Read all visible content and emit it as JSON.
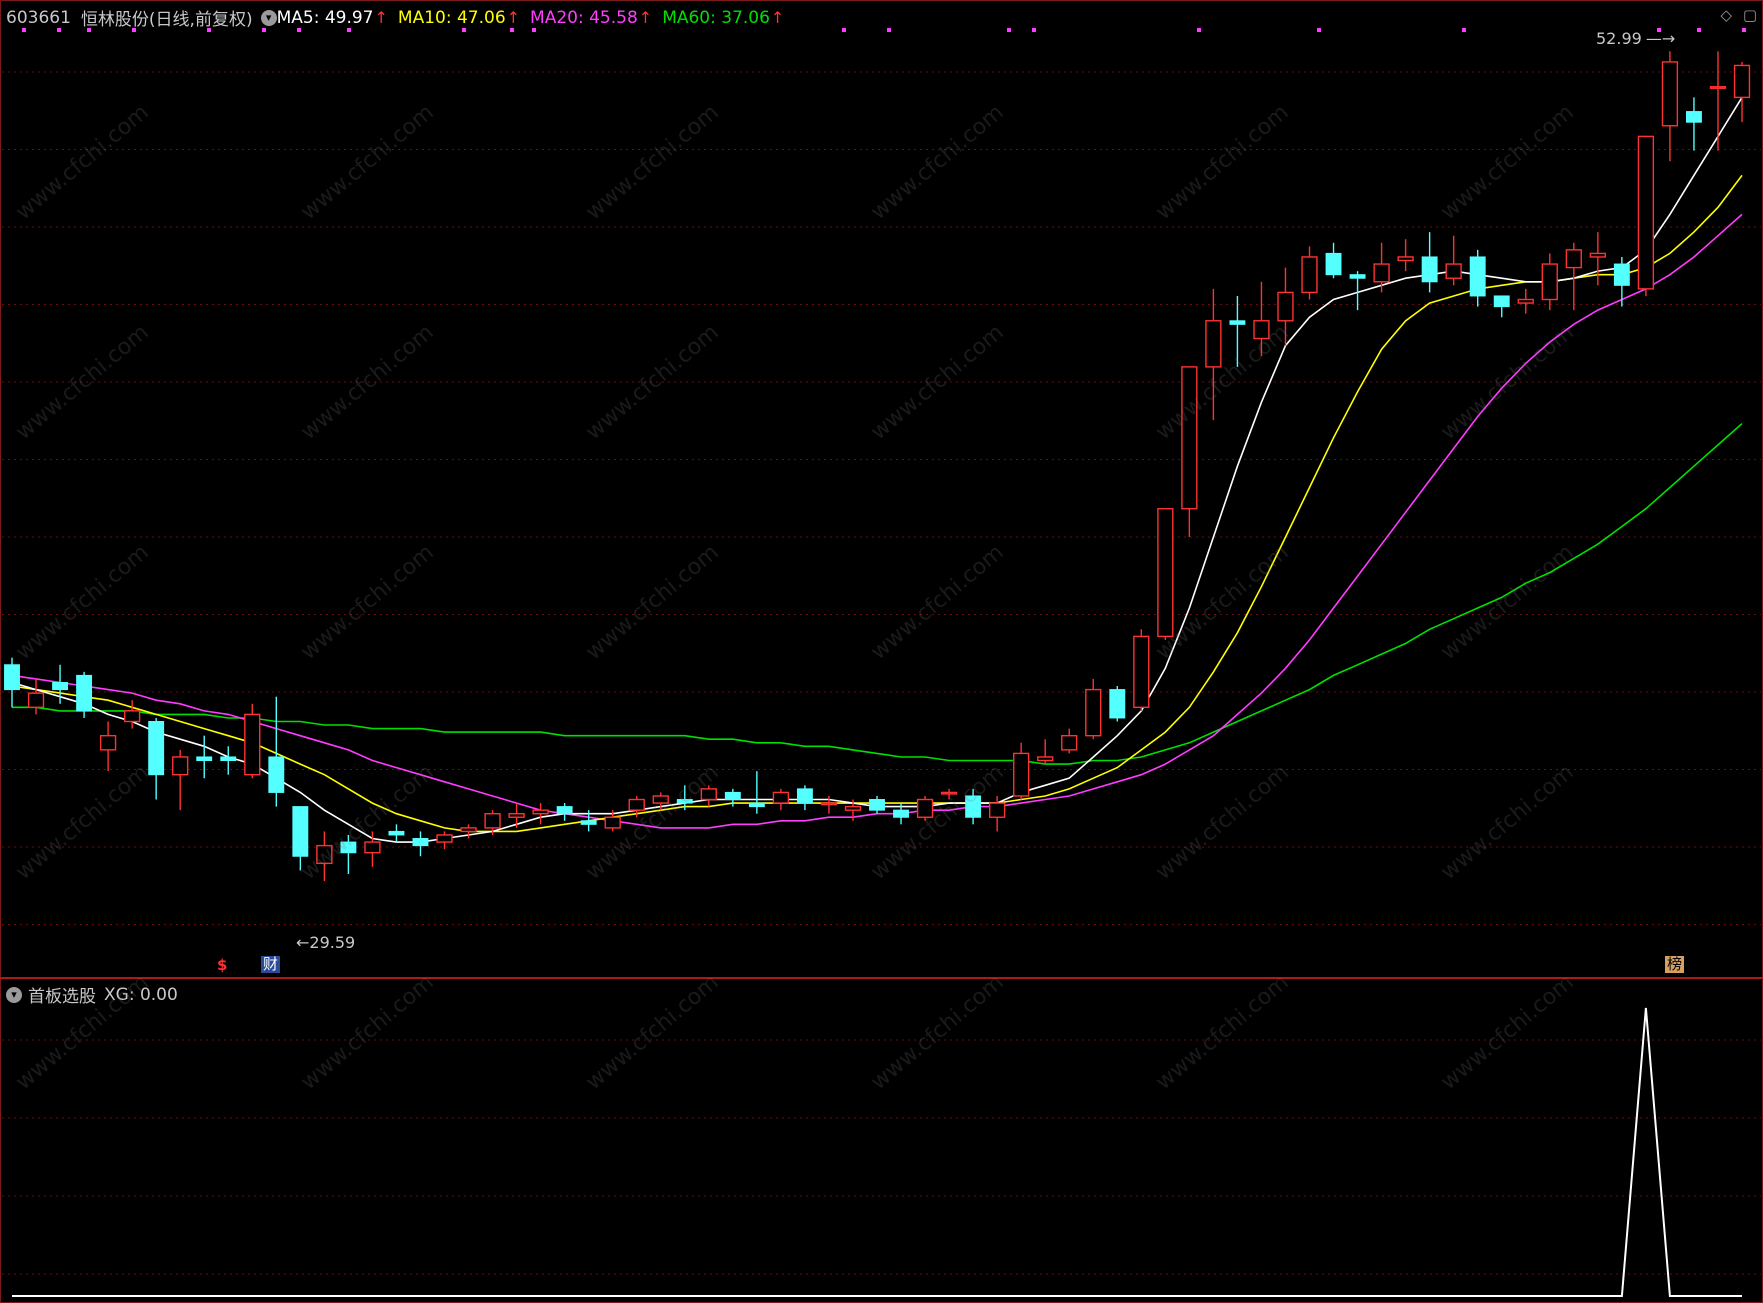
{
  "header": {
    "stock_code": "603661",
    "stock_name": "恒林股份",
    "period": "(日线,前复权)",
    "ma": [
      {
        "label": "MA5: 49.97",
        "color": "#ffffff"
      },
      {
        "label": "MA10: 47.06",
        "color": "#ffff00"
      },
      {
        "label": "MA20: 45.58",
        "color": "#ff3cff"
      },
      {
        "label": "MA60: 37.06",
        "color": "#00e000"
      }
    ],
    "up_arrow": "↑"
  },
  "annotations": {
    "high_label": "52.99",
    "low_label": "29.59",
    "tag_s": "$",
    "tag_cai": "财",
    "tag_bang": "榜"
  },
  "indicator": {
    "name": "首板选股",
    "value_label": "XG: 0.00"
  },
  "watermark": "www.cfchi.com",
  "colors": {
    "up": "#ff3232",
    "down": "#54ffff",
    "ma5": "#ffffff",
    "ma10": "#ffff00",
    "ma20": "#ff3cff",
    "ma60": "#00e000",
    "grid": "#6a0d0d"
  },
  "chart_data": {
    "type": "candlestick",
    "price_range": [
      28.5,
      54.5
    ],
    "candles": [
      {
        "o": 36.6,
        "c": 35.9,
        "h": 36.8,
        "l": 35.4
      },
      {
        "o": 35.4,
        "c": 35.8,
        "h": 36.2,
        "l": 35.2
      },
      {
        "o": 36.1,
        "c": 35.9,
        "h": 36.6,
        "l": 35.5
      },
      {
        "o": 36.3,
        "c": 35.3,
        "h": 36.4,
        "l": 35.1
      },
      {
        "o": 34.2,
        "c": 34.6,
        "h": 35.0,
        "l": 33.6
      },
      {
        "o": 35.0,
        "c": 35.3,
        "h": 35.6,
        "l": 34.8
      },
      {
        "o": 35.0,
        "c": 33.5,
        "h": 35.1,
        "l": 32.8
      },
      {
        "o": 33.5,
        "c": 34.0,
        "h": 34.2,
        "l": 32.5
      },
      {
        "o": 34.0,
        "c": 33.9,
        "h": 34.6,
        "l": 33.4
      },
      {
        "o": 34.0,
        "c": 33.9,
        "h": 34.3,
        "l": 33.5
      },
      {
        "o": 33.5,
        "c": 35.2,
        "h": 35.5,
        "l": 33.4
      },
      {
        "o": 34.0,
        "c": 33.0,
        "h": 35.7,
        "l": 32.6
      },
      {
        "o": 32.6,
        "c": 31.2,
        "h": 32.6,
        "l": 30.8
      },
      {
        "o": 31.0,
        "c": 31.5,
        "h": 31.9,
        "l": 30.5
      },
      {
        "o": 31.6,
        "c": 31.3,
        "h": 31.8,
        "l": 30.7
      },
      {
        "o": 31.3,
        "c": 31.6,
        "h": 31.9,
        "l": 30.9
      },
      {
        "o": 31.9,
        "c": 31.8,
        "h": 32.1,
        "l": 31.6
      },
      {
        "o": 31.7,
        "c": 31.5,
        "h": 31.9,
        "l": 31.2
      },
      {
        "o": 31.6,
        "c": 31.8,
        "h": 31.9,
        "l": 31.4
      },
      {
        "o": 31.9,
        "c": 32.0,
        "h": 32.1,
        "l": 31.7
      },
      {
        "o": 32.0,
        "c": 32.4,
        "h": 32.5,
        "l": 31.8
      },
      {
        "o": 32.3,
        "c": 32.4,
        "h": 32.7,
        "l": 32.0
      },
      {
        "o": 32.4,
        "c": 32.5,
        "h": 32.7,
        "l": 32.1
      },
      {
        "o": 32.6,
        "c": 32.4,
        "h": 32.7,
        "l": 32.2
      },
      {
        "o": 32.2,
        "c": 32.1,
        "h": 32.5,
        "l": 31.9
      },
      {
        "o": 32.0,
        "c": 32.3,
        "h": 32.5,
        "l": 31.9
      },
      {
        "o": 32.5,
        "c": 32.8,
        "h": 32.9,
        "l": 32.3
      },
      {
        "o": 32.7,
        "c": 32.9,
        "h": 33.0,
        "l": 32.5
      },
      {
        "o": 32.8,
        "c": 32.7,
        "h": 33.2,
        "l": 32.5
      },
      {
        "o": 32.8,
        "c": 33.1,
        "h": 33.2,
        "l": 32.6
      },
      {
        "o": 33.0,
        "c": 32.8,
        "h": 33.1,
        "l": 32.6
      },
      {
        "o": 32.7,
        "c": 32.6,
        "h": 33.6,
        "l": 32.4
      },
      {
        "o": 32.7,
        "c": 33.0,
        "h": 33.1,
        "l": 32.5
      },
      {
        "o": 33.1,
        "c": 32.7,
        "h": 33.2,
        "l": 32.5
      },
      {
        "o": 32.7,
        "c": 32.7,
        "h": 32.9,
        "l": 32.4
      },
      {
        "o": 32.5,
        "c": 32.6,
        "h": 32.8,
        "l": 32.2
      },
      {
        "o": 32.8,
        "c": 32.5,
        "h": 32.9,
        "l": 32.4
      },
      {
        "o": 32.5,
        "c": 32.3,
        "h": 32.7,
        "l": 32.1
      },
      {
        "o": 32.3,
        "c": 32.8,
        "h": 32.9,
        "l": 32.2
      },
      {
        "o": 33.0,
        "c": 33.0,
        "h": 33.1,
        "l": 32.8
      },
      {
        "o": 32.9,
        "c": 32.3,
        "h": 33.1,
        "l": 32.1
      },
      {
        "o": 32.3,
        "c": 32.7,
        "h": 32.9,
        "l": 31.9
      },
      {
        "o": 32.9,
        "c": 34.1,
        "h": 34.4,
        "l": 32.8
      },
      {
        "o": 33.9,
        "c": 34.0,
        "h": 34.5,
        "l": 33.8
      },
      {
        "o": 34.2,
        "c": 34.6,
        "h": 34.8,
        "l": 34.1
      },
      {
        "o": 34.6,
        "c": 35.9,
        "h": 36.2,
        "l": 34.5
      },
      {
        "o": 35.9,
        "c": 35.1,
        "h": 36.0,
        "l": 35.0
      },
      {
        "o": 35.4,
        "c": 37.4,
        "h": 37.6,
        "l": 35.3
      },
      {
        "o": 37.4,
        "c": 41.0,
        "h": 41.0,
        "l": 37.3
      },
      {
        "o": 41.0,
        "c": 45.0,
        "h": 45.0,
        "l": 40.2
      },
      {
        "o": 45.0,
        "c": 46.3,
        "h": 47.2,
        "l": 43.5
      },
      {
        "o": 46.3,
        "c": 46.2,
        "h": 47.0,
        "l": 45.0
      },
      {
        "o": 45.8,
        "c": 46.3,
        "h": 47.4,
        "l": 45.3
      },
      {
        "o": 46.3,
        "c": 47.1,
        "h": 47.8,
        "l": 45.6
      },
      {
        "o": 47.1,
        "c": 48.1,
        "h": 48.4,
        "l": 46.9
      },
      {
        "o": 48.2,
        "c": 47.6,
        "h": 48.5,
        "l": 47.5
      },
      {
        "o": 47.6,
        "c": 47.5,
        "h": 47.7,
        "l": 46.6
      },
      {
        "o": 47.4,
        "c": 47.9,
        "h": 48.5,
        "l": 47.1
      },
      {
        "o": 48.0,
        "c": 48.1,
        "h": 48.6,
        "l": 47.7
      },
      {
        "o": 48.1,
        "c": 47.4,
        "h": 48.8,
        "l": 47.1
      },
      {
        "o": 47.5,
        "c": 47.9,
        "h": 48.7,
        "l": 47.3
      },
      {
        "o": 48.1,
        "c": 47.0,
        "h": 48.3,
        "l": 46.7
      },
      {
        "o": 47.0,
        "c": 46.7,
        "h": 47.0,
        "l": 46.4
      },
      {
        "o": 46.8,
        "c": 46.9,
        "h": 47.2,
        "l": 46.5
      },
      {
        "o": 46.9,
        "c": 47.9,
        "h": 48.2,
        "l": 46.6
      },
      {
        "o": 47.8,
        "c": 48.3,
        "h": 48.5,
        "l": 46.6
      },
      {
        "o": 48.1,
        "c": 48.2,
        "h": 48.8,
        "l": 47.3
      },
      {
        "o": 47.9,
        "c": 47.3,
        "h": 48.1,
        "l": 46.7
      },
      {
        "o": 47.2,
        "c": 51.5,
        "h": 51.5,
        "l": 47.0
      },
      {
        "o": 51.8,
        "c": 53.6,
        "h": 53.9,
        "l": 50.8
      },
      {
        "o": 52.2,
        "c": 51.9,
        "h": 52.6,
        "l": 51.1
      },
      {
        "o": 52.9,
        "c": 52.9,
        "h": 53.9,
        "l": 51.1
      },
      {
        "o": 52.6,
        "c": 53.5,
        "h": 53.6,
        "l": 51.9
      }
    ],
    "ma5": [
      36.1,
      35.9,
      35.7,
      35.5,
      35.2,
      35.0,
      34.7,
      34.5,
      34.3,
      34.0,
      33.8,
      33.4,
      33.0,
      32.5,
      32.1,
      31.7,
      31.6,
      31.6,
      31.7,
      31.8,
      31.9,
      32.1,
      32.3,
      32.4,
      32.4,
      32.4,
      32.5,
      32.6,
      32.7,
      32.8,
      32.8,
      32.8,
      32.8,
      32.8,
      32.8,
      32.7,
      32.6,
      32.6,
      32.6,
      32.7,
      32.7,
      32.7,
      33.0,
      33.2,
      33.4,
      34.0,
      34.6,
      35.3,
      36.5,
      38.2,
      40.2,
      42.2,
      44.0,
      45.6,
      46.4,
      46.9,
      47.1,
      47.3,
      47.5,
      47.6,
      47.7,
      47.6,
      47.5,
      47.4,
      47.4,
      47.5,
      47.7,
      47.8,
      48.3,
      49.3,
      50.4,
      51.5,
      52.6
    ],
    "ma10": [
      36.0,
      35.9,
      35.8,
      35.7,
      35.6,
      35.4,
      35.2,
      35.0,
      34.8,
      34.6,
      34.4,
      34.1,
      33.8,
      33.5,
      33.1,
      32.7,
      32.4,
      32.2,
      32.0,
      31.9,
      31.9,
      31.9,
      32.0,
      32.1,
      32.2,
      32.3,
      32.4,
      32.5,
      32.6,
      32.6,
      32.7,
      32.7,
      32.7,
      32.7,
      32.7,
      32.7,
      32.7,
      32.7,
      32.7,
      32.7,
      32.7,
      32.7,
      32.8,
      32.9,
      33.1,
      33.4,
      33.7,
      34.2,
      34.7,
      35.4,
      36.4,
      37.5,
      38.8,
      40.2,
      41.6,
      43.0,
      44.3,
      45.5,
      46.3,
      46.8,
      47.0,
      47.2,
      47.3,
      47.4,
      47.4,
      47.5,
      47.6,
      47.6,
      47.8,
      48.2,
      48.8,
      49.5,
      50.4
    ],
    "ma20": [
      36.3,
      36.2,
      36.1,
      36.0,
      35.9,
      35.8,
      35.6,
      35.5,
      35.3,
      35.2,
      35.0,
      34.8,
      34.6,
      34.4,
      34.2,
      33.9,
      33.7,
      33.5,
      33.3,
      33.1,
      32.9,
      32.7,
      32.5,
      32.4,
      32.3,
      32.2,
      32.1,
      32.0,
      32.0,
      32.0,
      32.1,
      32.1,
      32.2,
      32.2,
      32.3,
      32.3,
      32.4,
      32.4,
      32.5,
      32.5,
      32.6,
      32.6,
      32.7,
      32.8,
      32.9,
      33.1,
      33.3,
      33.5,
      33.8,
      34.2,
      34.6,
      35.2,
      35.8,
      36.5,
      37.3,
      38.2,
      39.1,
      40.0,
      40.9,
      41.8,
      42.7,
      43.6,
      44.4,
      45.1,
      45.7,
      46.2,
      46.6,
      46.9,
      47.2,
      47.6,
      48.1,
      48.7,
      49.3
    ],
    "ma60": [
      35.4,
      35.4,
      35.3,
      35.3,
      35.3,
      35.3,
      35.2,
      35.2,
      35.2,
      35.1,
      35.1,
      35.0,
      35.0,
      34.9,
      34.9,
      34.8,
      34.8,
      34.8,
      34.7,
      34.7,
      34.7,
      34.7,
      34.7,
      34.6,
      34.6,
      34.6,
      34.6,
      34.6,
      34.6,
      34.5,
      34.5,
      34.4,
      34.4,
      34.3,
      34.3,
      34.2,
      34.1,
      34.0,
      34.0,
      33.9,
      33.9,
      33.9,
      33.9,
      33.8,
      33.8,
      33.9,
      33.9,
      34.0,
      34.2,
      34.4,
      34.7,
      35.0,
      35.3,
      35.6,
      35.9,
      36.3,
      36.6,
      36.9,
      37.2,
      37.6,
      37.9,
      38.2,
      38.5,
      38.9,
      39.2,
      39.6,
      40.0,
      40.5,
      41.0,
      41.6,
      42.2,
      42.8,
      43.4
    ],
    "xg": [
      0,
      0,
      0,
      0,
      0,
      0,
      0,
      0,
      0,
      0,
      0,
      0,
      0,
      0,
      0,
      0,
      0,
      0,
      0,
      0,
      0,
      0,
      0,
      0,
      0,
      0,
      0,
      0,
      0,
      0,
      0,
      0,
      0,
      0,
      0,
      0,
      0,
      0,
      0,
      0,
      0,
      0,
      0,
      0,
      0,
      0,
      0,
      0,
      0,
      0,
      0,
      0,
      0,
      0,
      0,
      0,
      0,
      0,
      0,
      0,
      0,
      0,
      0,
      0,
      0,
      0,
      0,
      0,
      1,
      0,
      0,
      0,
      0
    ],
    "xg_range": [
      0,
      1
    ]
  }
}
